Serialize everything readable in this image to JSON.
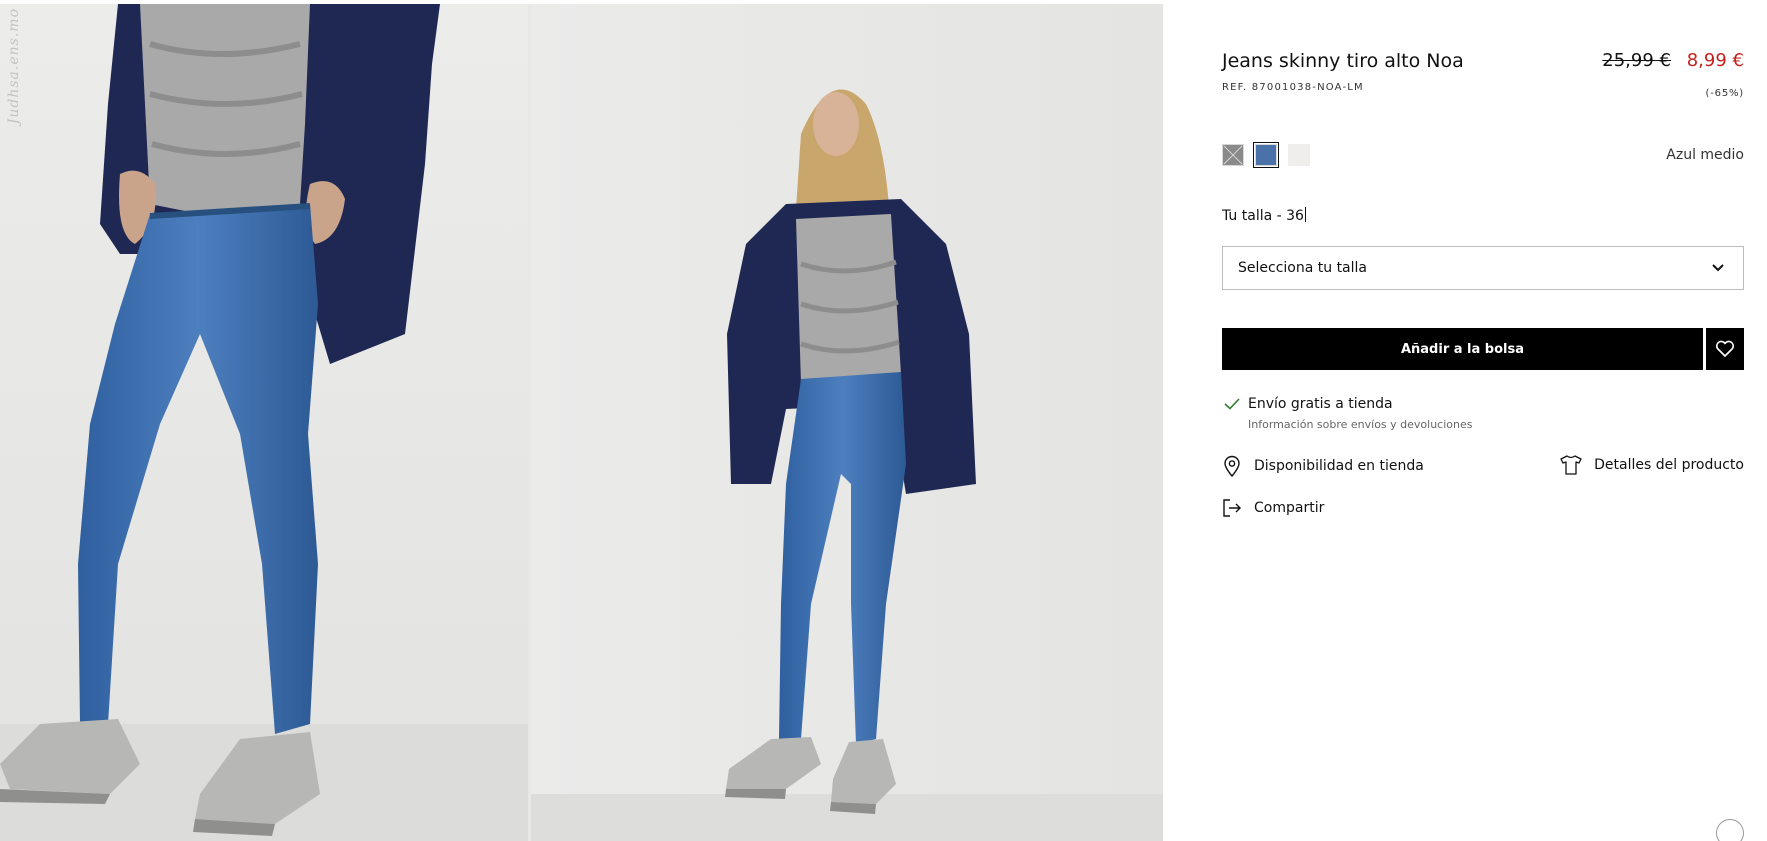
{
  "gallery": {
    "watermark": "Judhsa.ens.mo"
  },
  "product": {
    "title": "Jeans skinny tiro alto Noa",
    "reference": "REF. 87001038-NOA-LM",
    "price_original": "25,99 €",
    "price_sale": "8,99 €",
    "discount": "(-65%)",
    "colors": [
      {
        "name": "Gris",
        "hex": "#8a8a8a",
        "available": false
      },
      {
        "name": "Azul medio",
        "hex": "#4a72a8",
        "selected": true
      },
      {
        "name": "Crudo",
        "hex": "#efeeea"
      }
    ],
    "selected_color_label": "Azul medio",
    "size_label": "Tu talla - 36",
    "size_select_placeholder": "Selecciona tu talla",
    "add_to_bag": "Añadir a la bolsa",
    "shipping_title": "Envío gratis a tienda",
    "shipping_info": "Información sobre envíos y devoluciones",
    "store_availability": "Disponibilidad en tienda",
    "product_details": "Detalles del producto",
    "share": "Compartir"
  },
  "theme": {
    "sale_color": "#c4221c",
    "button_bg": "#000000",
    "button_text": "#ffffff",
    "denim_blue": "#3f6fae"
  },
  "icons": [
    "check-icon",
    "location-pin-icon",
    "tshirt-icon",
    "share-icon",
    "heart-icon",
    "chevron-down-icon"
  ]
}
